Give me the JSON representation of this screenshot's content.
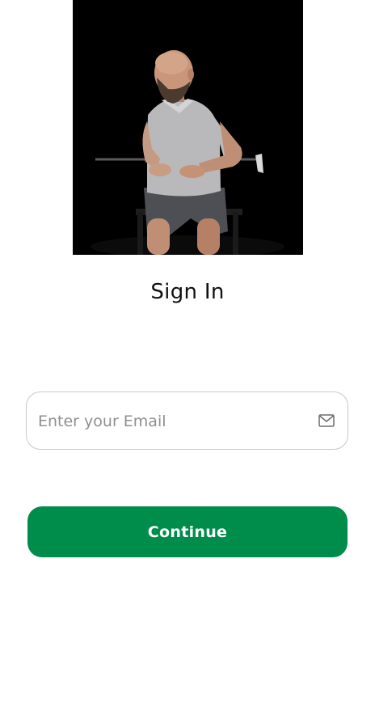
{
  "hero": {
    "alt": "Man seated on a chair holding a golf club behind his back, rotating torso"
  },
  "signin": {
    "title": "Sign In"
  },
  "email": {
    "placeholder": "Enter your Email",
    "value": ""
  },
  "actions": {
    "continue_label": "Continue"
  },
  "colors": {
    "accent": "#008d4c",
    "hero_background": "#000000"
  },
  "icons": {
    "email": "mail-icon"
  }
}
